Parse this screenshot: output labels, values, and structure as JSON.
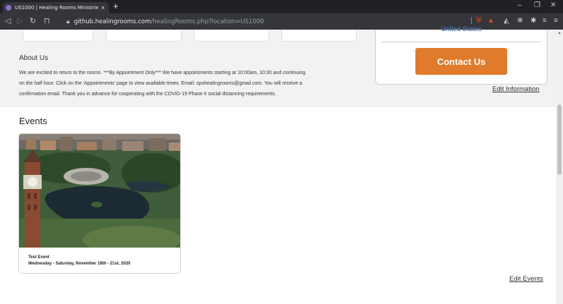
{
  "browser": {
    "tab_title": "US1000 | Healing Rooms Ministrie",
    "tab_close": "×",
    "new_tab": "+",
    "url_host": "github.healingrooms.com",
    "url_path": "/healingRooms.php?location=US1000",
    "nav_icons": [
      "back-icon",
      "forward-icon",
      "reload-icon",
      "bookmark-icon"
    ],
    "window_controls": [
      "minimize-icon",
      "restore-icon",
      "close-icon"
    ]
  },
  "about": {
    "title": "About Us",
    "line1": "We are excited to return to the rooms. ***By Appointment Only*** We have appointments starting at 10:00am, 10:30 and continuing",
    "line2": "on the half hour. Click on the 'Appointments' page to view available times. Email: spohealingrooms@gmail.com. You will receive a",
    "line3": "confirmation email. Thank you in advance for cooperating with the COVID-19 Phase II social distancing requirements."
  },
  "contact": {
    "country": "United States",
    "button_label": "Contact Us"
  },
  "edit_information": "Edit Information",
  "events": {
    "title": "Events",
    "items": [
      {
        "name": "Test Event",
        "date": "Wednesday - Saturday, November 18th - 21st, 2020"
      }
    ],
    "edit_label": "Edit Events"
  },
  "colors": {
    "accent": "#e07b2c",
    "link_blue": "#4a6fa5",
    "band": "#f2f2f2"
  }
}
